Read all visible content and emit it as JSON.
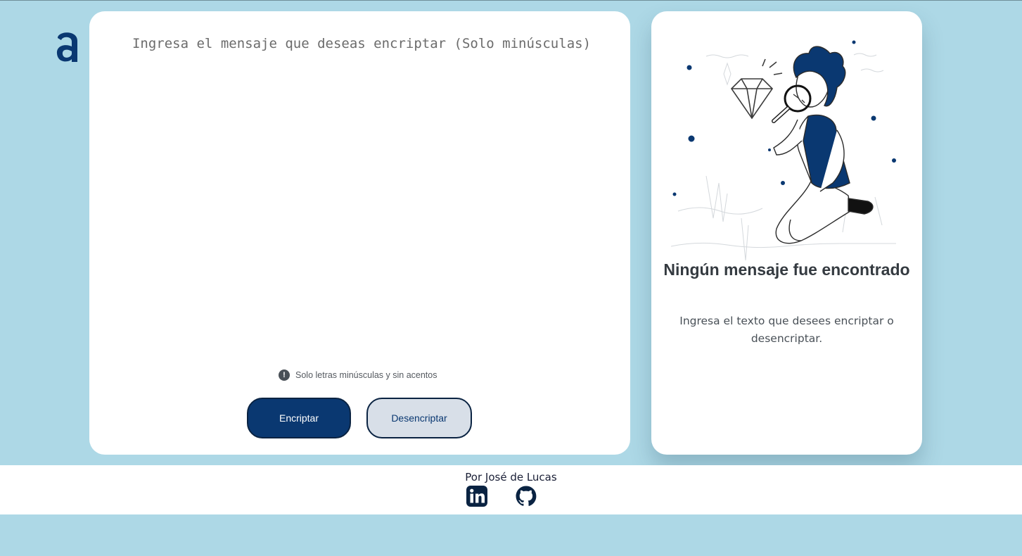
{
  "app": {
    "logo_icon": "alura-a-logo-icon",
    "brand_color": "#0a3871",
    "background_color": "#add8e6"
  },
  "input": {
    "placeholder": "Ingresa el mensaje que deseas encriptar (Solo minúsculas)",
    "value": "",
    "hint_icon": "exclamation-circle-icon",
    "hint": "Solo letras minúsculas y sin acentos",
    "encrypt_label": "Encriptar",
    "decrypt_label": "Desencriptar"
  },
  "output": {
    "illustration": "person-with-magnifying-glass-diamond-illustration",
    "title": "Ningún mensaje fue encontrado",
    "description": "Ingresa el texto que desees encriptar o desencriptar."
  },
  "footer": {
    "author": "Por José de Lucas",
    "links": [
      {
        "name": "linkedin",
        "icon": "linkedin-icon"
      },
      {
        "name": "github",
        "icon": "github-icon"
      }
    ]
  }
}
